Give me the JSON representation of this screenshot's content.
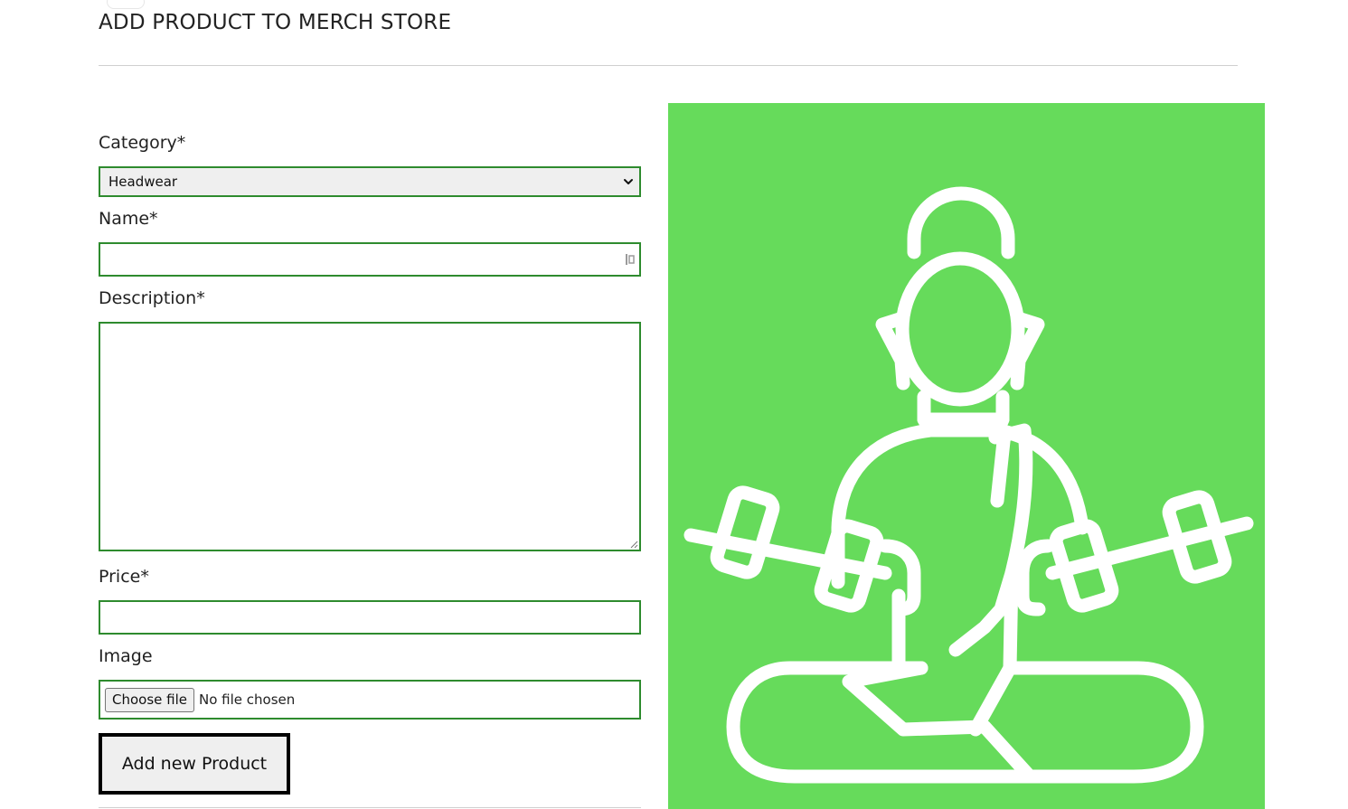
{
  "page": {
    "title": "ADD PRODUCT TO MERCH STORE"
  },
  "form": {
    "category": {
      "label": "Category*",
      "selected": "Headwear"
    },
    "name": {
      "label": "Name*",
      "value": ""
    },
    "description": {
      "label": "Description*",
      "value": ""
    },
    "price": {
      "label": "Price*",
      "value": ""
    },
    "image": {
      "label": "Image",
      "button_label": "Choose file",
      "status": "No file chosen"
    },
    "submit_label": "Add new Product"
  },
  "preview": {
    "background": "#66db5b",
    "icon": "meditating-figure-with-dumbbells-icon"
  },
  "colors": {
    "field_border": "#2e8b2e",
    "divider": "#cfcfcf"
  }
}
